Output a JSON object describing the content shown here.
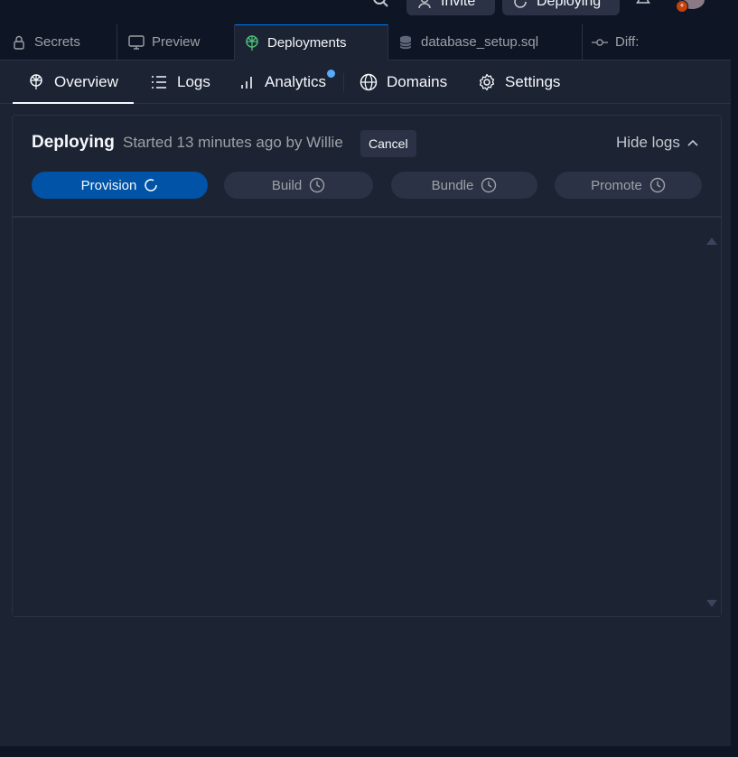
{
  "topbar": {
    "search_icon": "search-icon",
    "invite_label": "Invite",
    "deploying_label": "Deploying",
    "bell_icon": "bell-icon",
    "avatar_badge": "+"
  },
  "tabs": [
    {
      "label": "Secrets",
      "icon": "lock-icon"
    },
    {
      "label": "Preview",
      "icon": "monitor-icon"
    },
    {
      "label": "Deployments",
      "icon": "deploy-icon",
      "active": true
    },
    {
      "label": "database_setup.sql",
      "icon": "database-icon"
    },
    {
      "label": "Diff:",
      "icon": "git-commit-icon"
    }
  ],
  "subnav": {
    "overview": "Overview",
    "logs": "Logs",
    "analytics": "Analytics",
    "domains": "Domains",
    "settings": "Settings"
  },
  "deployment": {
    "status": "Deploying",
    "meta": "Started 13 minutes ago by Willie",
    "cancel_label": "Cancel",
    "hide_logs_label": "Hide logs",
    "steps": [
      {
        "label": "Provision",
        "state": "in-progress"
      },
      {
        "label": "Build",
        "state": "pending"
      },
      {
        "label": "Bundle",
        "state": "pending"
      },
      {
        "label": "Promote",
        "state": "pending"
      }
    ]
  },
  "colors": {
    "background": "#0e1525",
    "panel": "#1c2333",
    "border": "#2b3245",
    "accent": "#0053a6",
    "active_tab_top": "#0079f2",
    "notification_dot": "#57abff",
    "deploy_icon": "#4cbf7a"
  }
}
